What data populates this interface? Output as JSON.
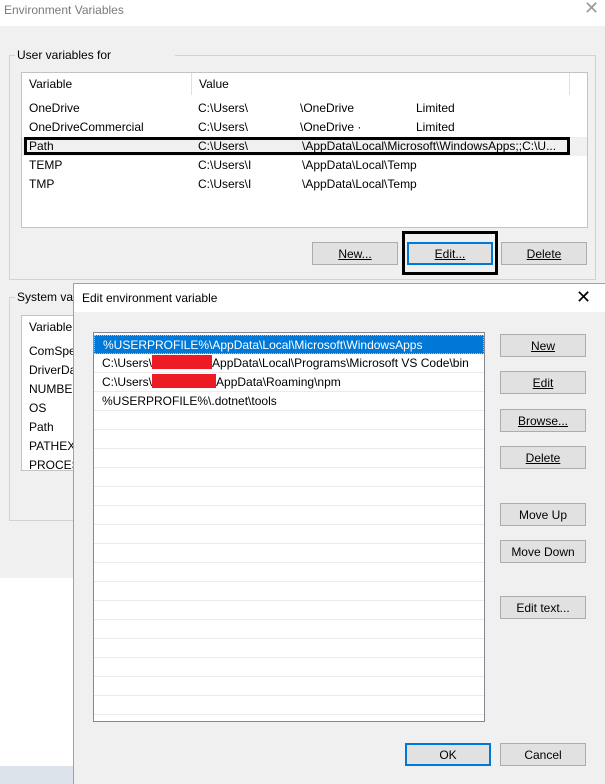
{
  "background_dialog": {
    "title": "Environment Variables",
    "user_group_label": "User variables for",
    "system_group_label": "System var",
    "user_table": {
      "headers": [
        "Variable",
        "Value"
      ],
      "rows": [
        {
          "variable": "OneDrive",
          "value": "C:\\Users\\",
          "value_tail": "\\OneDrive",
          "extra": "Limited"
        },
        {
          "variable": "OneDriveCommercial",
          "value": "C:\\Users\\",
          "value_tail": "\\OneDrive ·",
          "extra": "Limited"
        },
        {
          "variable": "Path",
          "value": "C:\\Users\\",
          "value_tail": "\\AppData\\Local\\Microsoft\\WindowsApps;;C:\\U...",
          "extra": ""
        },
        {
          "variable": "TEMP",
          "value": "C:\\Users\\I",
          "value_tail": "\\AppData\\Local\\Temp",
          "extra": ""
        },
        {
          "variable": "TMP",
          "value": "C:\\Users\\I",
          "value_tail": "\\AppData\\Local\\Temp",
          "extra": ""
        }
      ]
    },
    "buttons": {
      "new": "New...",
      "edit": "Edit...",
      "delete": "Delete"
    },
    "system_table": {
      "header": "Variable",
      "rows": [
        "ComSpe",
        "DriverDa",
        "NUMBER",
        "OS",
        "Path",
        "PATHEXT",
        "PROCESS"
      ]
    }
  },
  "edit_dialog": {
    "title": "Edit environment variable",
    "entries": [
      {
        "text": "%USERPROFILE%\\AppData\\Local\\Microsoft\\WindowsApps",
        "selected": true
      },
      {
        "pre": "C:\\Users\\",
        "post": "AppData\\Local\\Programs\\Microsoft VS Code\\bin",
        "redacted": true
      },
      {
        "pre": "C:\\Users\\",
        "post": "AppData\\Roaming\\npm",
        "redacted": true
      },
      {
        "text": "%USERPROFILE%\\.dotnet\\tools"
      }
    ],
    "buttons": {
      "new": "New",
      "edit": "Edit",
      "browse": "Browse...",
      "delete": "Delete",
      "move_up": "Move Up",
      "move_down": "Move Down",
      "edit_text": "Edit text...",
      "ok": "OK",
      "cancel": "Cancel"
    }
  },
  "colors": {
    "selection": "#0078d7",
    "redaction": "#ed1c24",
    "dialog_bg": "#f0f0f0"
  }
}
